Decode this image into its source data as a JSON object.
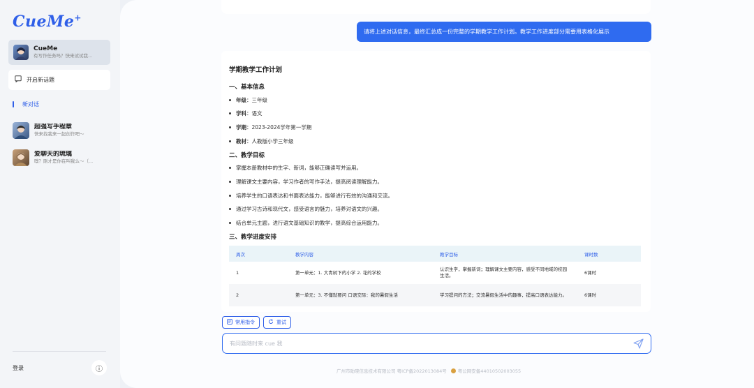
{
  "app": {
    "logo_text": "CueMe",
    "logo_spark": "+"
  },
  "sidebar": {
    "agent": {
      "name": "CueMe",
      "subtitle": "有写作任务吗？快来试试我..."
    },
    "new_topic_label": "开启新话题",
    "conversation_label": "新对话",
    "chats": [
      {
        "name": "超强写手程章",
        "subtitle": "快来找我来一起创作吧～"
      },
      {
        "name": "爱聊天的琉璃",
        "subtitle": "嗅？刚才是你在叫我么～（..."
      }
    ],
    "login_label": "登录",
    "info_icon": "ⓘ"
  },
  "chat": {
    "user_message": "请将上述对话信息，最终汇总成一份完整的学期教学工作计划。教学工作进度部分需要用表格化展示",
    "answer": {
      "title": "学期教学工作计划",
      "section1": "一、基本信息",
      "basic": [
        {
          "label": "年级",
          "value": "：三年级"
        },
        {
          "label": "学科",
          "value": "：语文"
        },
        {
          "label": "学期",
          "value": "：2023-2024学年第一学期"
        },
        {
          "label": "教材",
          "value": "：人教版小学三年级"
        }
      ],
      "section2": "二、教学目标",
      "goals": [
        "掌握本册教材中的生字、新词，能够正确读写并运用。",
        "理解课文主要内容，学习作者的写作手法，提高阅读理解能力。",
        "培养学生的口语表达和书面表达能力，能够进行有效的沟通和交流。",
        "通过学习古诗和现代文，感受语言的魅力，培养对语文的兴趣。",
        "结合单元主题，进行语文基础知识的教学，提高综合运用能力。"
      ],
      "section3": "三、教学进度安排",
      "table": {
        "headers": [
          "周次",
          "教学内容",
          "教学目标",
          "课时数"
        ],
        "rows": [
          [
            "1",
            "第一单元：1. 大青树下的小学 2. 花的学校",
            "认识生字，掌握新词；理解课文主要内容，感受不同地域的校园生活。",
            "6课时"
          ],
          [
            "2",
            "第一单元：3. 不懂就要问 口语交际：我的暑假生活",
            "学习提问的方法；交流暑假生活中的趣事，提高口语表达能力。",
            "6课时"
          ],
          [
            "",
            "",
            "",
            ""
          ]
        ]
      }
    }
  },
  "composer": {
    "chip_commands": "常用指令",
    "chip_retry": "重试",
    "placeholder": "有问题随时来 cue 我",
    "value": ""
  },
  "footer": {
    "company": "广州市助晓信息技术有限公司 粤ICP备2022013084号",
    "police": "粤公网安备44010502003055"
  },
  "colors": {
    "accent": "#2f6bf0",
    "header_bg": "#eaf4f8"
  }
}
